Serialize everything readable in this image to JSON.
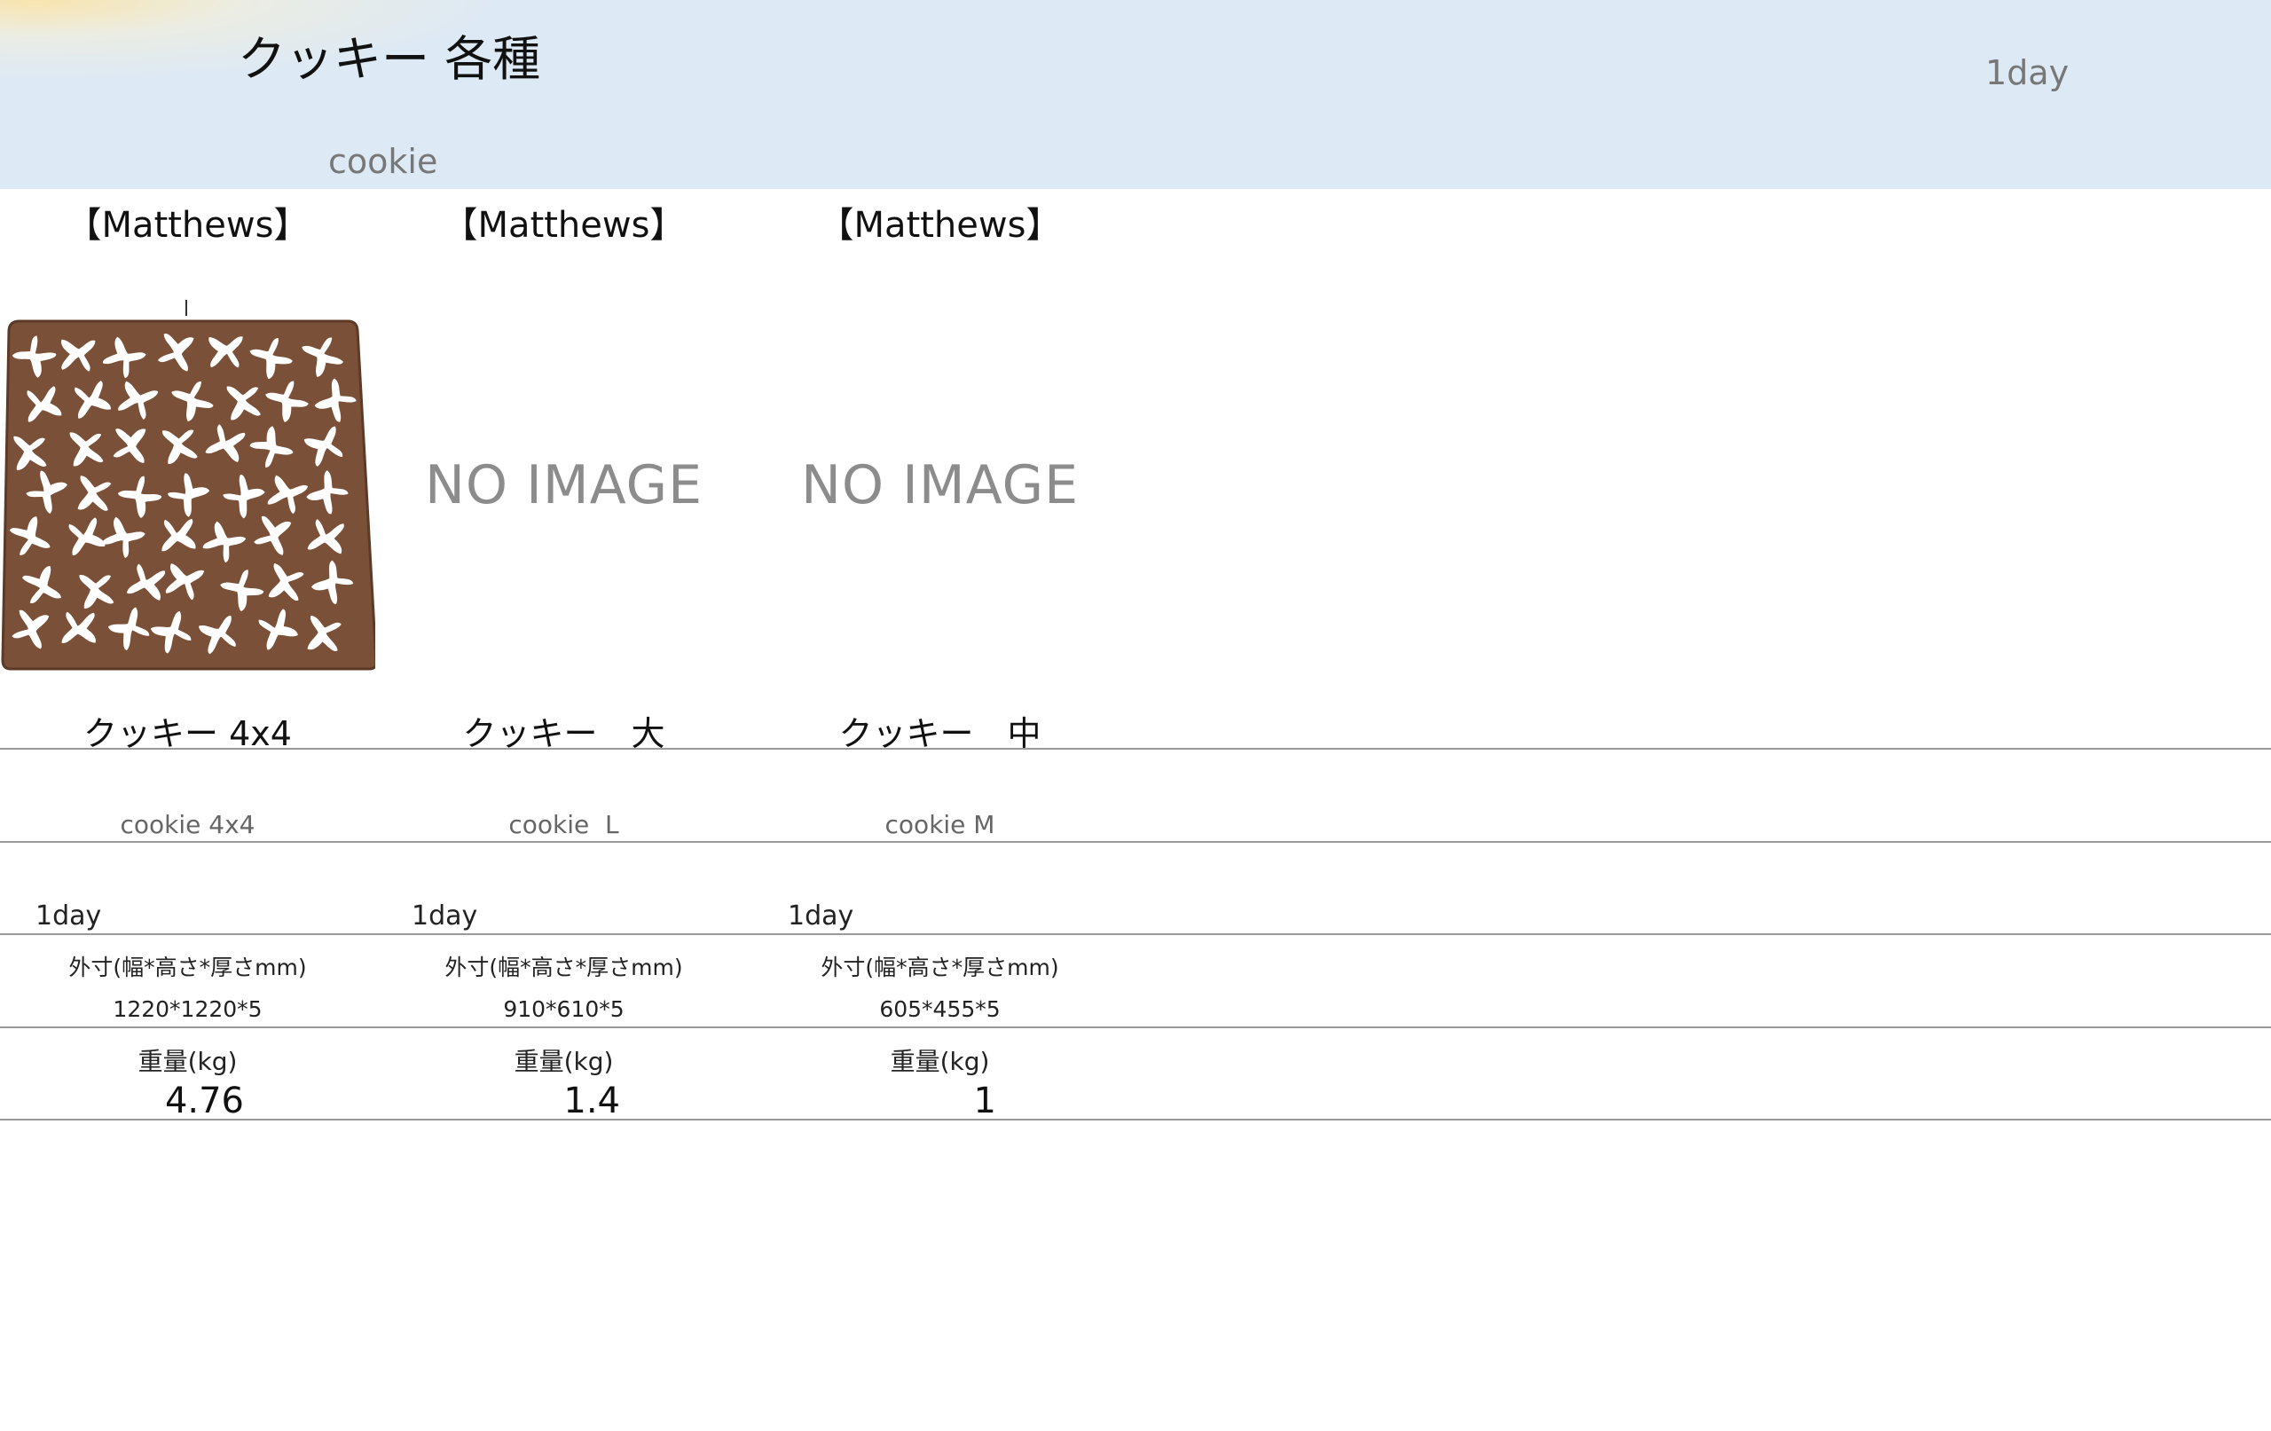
{
  "header": {
    "title": "クッキー 各種",
    "subtitle": "cookie",
    "lead_time": "1day"
  },
  "products": [
    {
      "brand": "【Matthews】",
      "image": "cookie-panel-photo",
      "no_image_text": "",
      "name_ja": "クッキー 4x4",
      "name_en": "cookie 4x4",
      "lead_time": "1day",
      "dimension_label": "外寸(幅*高さ*厚さmm)",
      "dimensions": "1220*1220*5",
      "weight_label": "重量(kg)",
      "weight": "4.76"
    },
    {
      "brand": "【Matthews】",
      "image": "",
      "no_image_text": "NO IMAGE",
      "name_ja": "クッキー　大",
      "name_en": "cookie  L",
      "lead_time": "1day",
      "dimension_label": "外寸(幅*高さ*厚さmm)",
      "dimensions": "910*610*5",
      "weight_label": "重量(kg)",
      "weight": "1.4"
    },
    {
      "brand": "【Matthews】",
      "image": "",
      "no_image_text": "NO IMAGE",
      "name_ja": "クッキー　中",
      "name_en": "cookie M",
      "lead_time": "1day",
      "dimension_label": "外寸(幅*高さ*厚さmm)",
      "dimensions": "605*455*5",
      "weight_label": "重量(kg)",
      "weight": "1"
    }
  ],
  "colors": {
    "header_bg": "#dde9f4",
    "panel_wood": "#7a5038",
    "muted_text": "#777777",
    "rule": "#999999"
  }
}
